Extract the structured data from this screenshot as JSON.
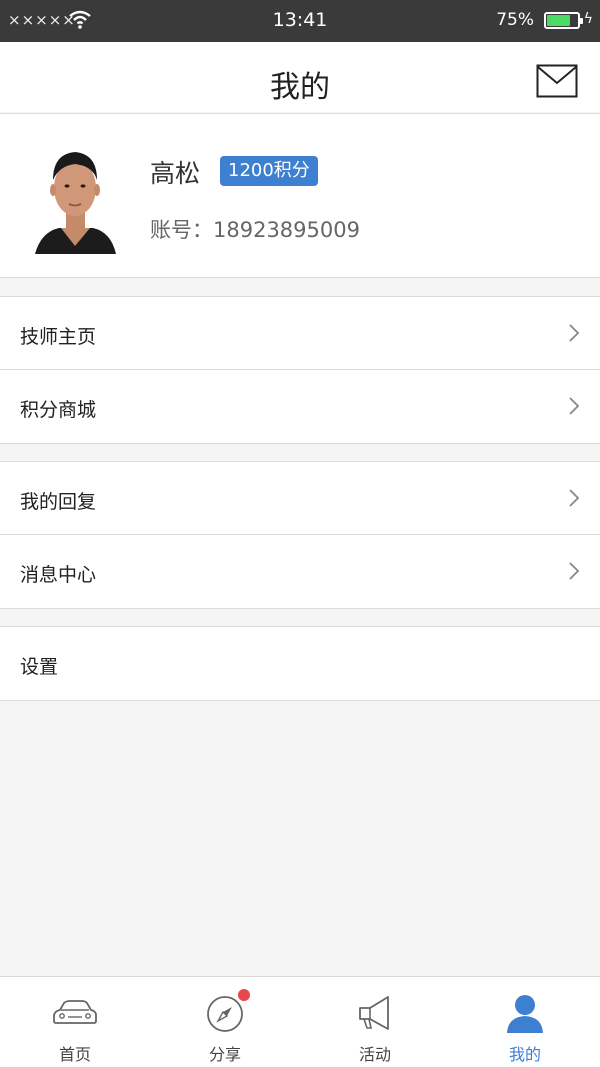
{
  "status_bar": {
    "signal": "×××××",
    "time": "13:41",
    "battery_percent": "75%",
    "battery_level": 0.75
  },
  "header": {
    "title": "我的",
    "mail_icon": "mail-icon"
  },
  "profile": {
    "name": "高松",
    "points_badge": "1200积分",
    "account": "账号：18923895009",
    "avatar_icon": "user-photo"
  },
  "menu_groups": [
    [
      {
        "label": "技师主页",
        "icon": "chevron-right-icon"
      },
      {
        "label": "积分商城",
        "icon": "chevron-right-icon"
      }
    ],
    [
      {
        "label": "我的回复",
        "icon": "chevron-right-icon"
      },
      {
        "label": "消息中心",
        "icon": "chevron-right-icon"
      }
    ],
    [
      {
        "label": "设置"
      }
    ]
  ],
  "tab_bar": {
    "tabs": [
      {
        "label": "首页",
        "icon": "car-icon"
      },
      {
        "label": "分享",
        "icon": "compass-icon",
        "has_notification_dot": true
      },
      {
        "label": "活动",
        "icon": "megaphone-icon"
      },
      {
        "label": "我的",
        "icon": "user-icon",
        "active": true
      }
    ],
    "active_color": "#3d7fd1",
    "notification_color": "#e8474c"
  }
}
